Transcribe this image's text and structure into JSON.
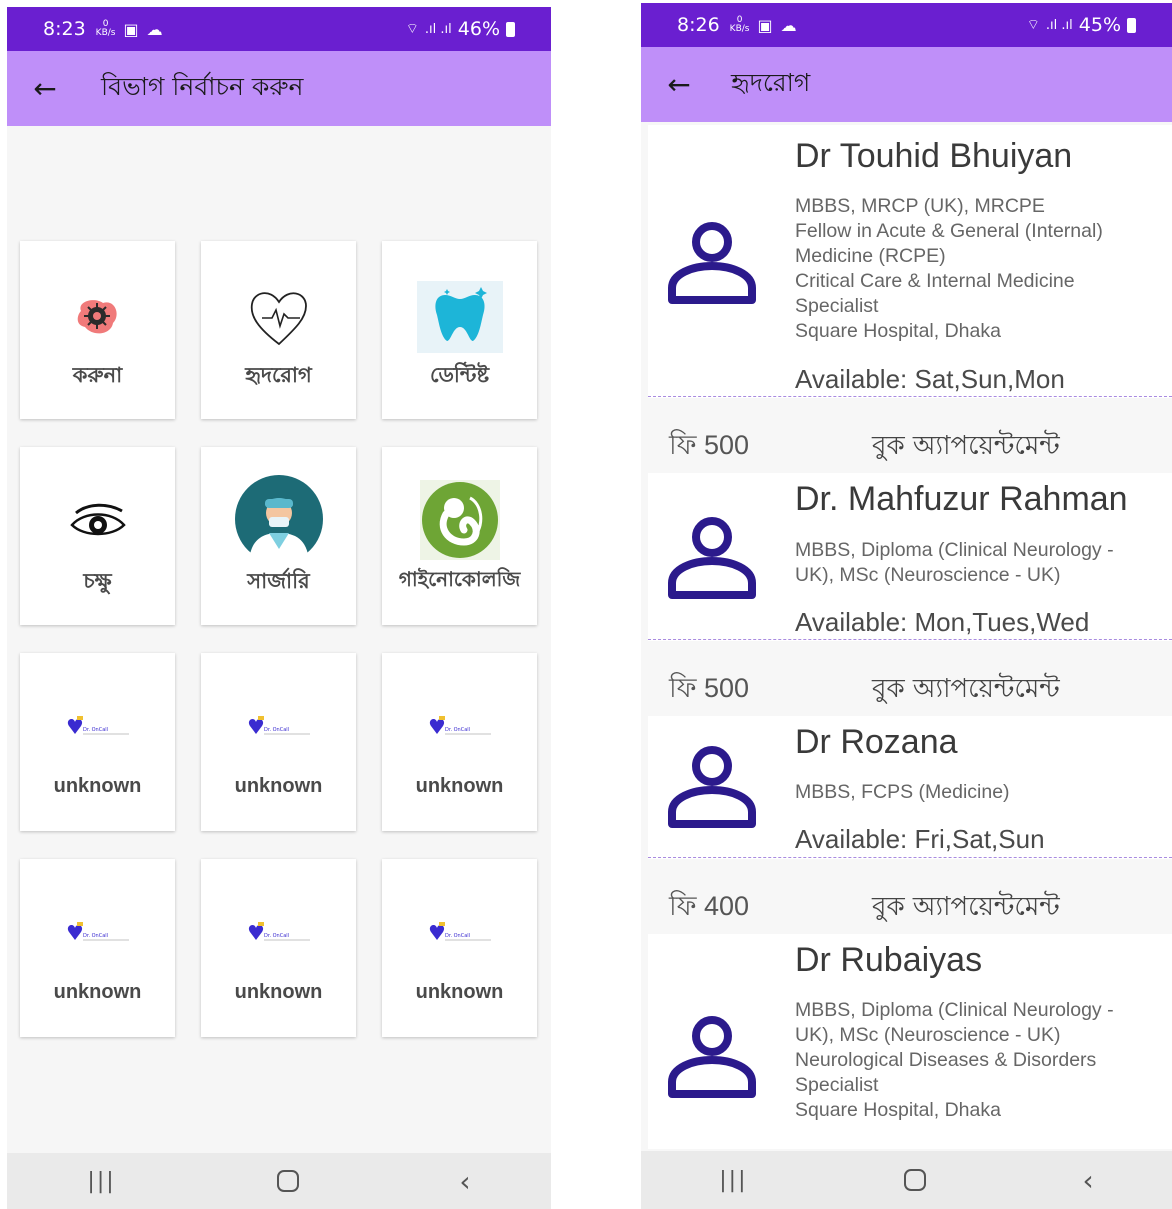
{
  "left_screen": {
    "status": {
      "time": "8:23",
      "kb": "0\nKB/s",
      "battery": "46%"
    },
    "appbar": {
      "title": "বিভাগ নির্বাচন করুন"
    },
    "departments": [
      {
        "label": "করুনা",
        "icon": "virus-icon"
      },
      {
        "label": "হৃদরোগ",
        "icon": "heart-icon"
      },
      {
        "label": "ডেন্টিষ্ট",
        "icon": "tooth-icon"
      },
      {
        "label": "চক্ষু",
        "icon": "eye-icon"
      },
      {
        "label": "সার্জারি",
        "icon": "surgeon-icon"
      },
      {
        "label": "গাইনোকোলজি",
        "icon": "fetus-icon"
      },
      {
        "label": "unknown",
        "icon": "dr-oncall-logo"
      },
      {
        "label": "unknown",
        "icon": "dr-oncall-logo"
      },
      {
        "label": "unknown",
        "icon": "dr-oncall-logo"
      },
      {
        "label": "unknown",
        "icon": "dr-oncall-logo"
      },
      {
        "label": "unknown",
        "icon": "dr-oncall-logo"
      },
      {
        "label": "unknown",
        "icon": "dr-oncall-logo"
      }
    ],
    "logo_text": "Dr. OnCall"
  },
  "right_screen": {
    "status": {
      "time": "8:26",
      "kb": "0\nKB/s",
      "battery": "45%"
    },
    "appbar": {
      "title": "হৃদরোগ"
    },
    "doctors": [
      {
        "name": "Dr Touhid Bhuiyan",
        "info": [
          "MBBS, MRCP (UK), MRCPE",
          "Fellow in Acute & General (Internal)",
          "Medicine (RCPE)",
          "Critical Care & Internal Medicine",
          "Specialist",
          "Square Hospital, Dhaka"
        ],
        "available": "Available: Sat,Sun,Mon",
        "fee": "ফি 500",
        "book": "বুক অ্যাপয়েন্টমেন্ট"
      },
      {
        "name": "Dr. Mahfuzur Rahman",
        "info": [
          "MBBS, Diploma (Clinical Neurology -",
          "UK), MSc (Neuroscience - UK)"
        ],
        "available": "Available: Mon,Tues,Wed",
        "fee": "ফি 500",
        "book": "বুক অ্যাপয়েন্টমেন্ট"
      },
      {
        "name": "Dr Rozana",
        "info": [
          "MBBS, FCPS (Medicine)"
        ],
        "available": "Available: Fri,Sat,Sun",
        "fee": "ফি 400",
        "book": "বুক অ্যাপয়েন্টমেন্ট"
      },
      {
        "name": "Dr Rubaiyas",
        "info": [
          "MBBS, Diploma (Clinical Neurology -",
          "UK), MSc (Neuroscience - UK)",
          "Neurological Diseases & Disorders",
          "Specialist",
          "Square Hospital, Dhaka"
        ]
      }
    ]
  },
  "colors": {
    "status_bar": "#6a1fd0",
    "app_bar": "#bf8ff9",
    "avatar": "#2b1a8c",
    "divider": "#a98be0"
  }
}
